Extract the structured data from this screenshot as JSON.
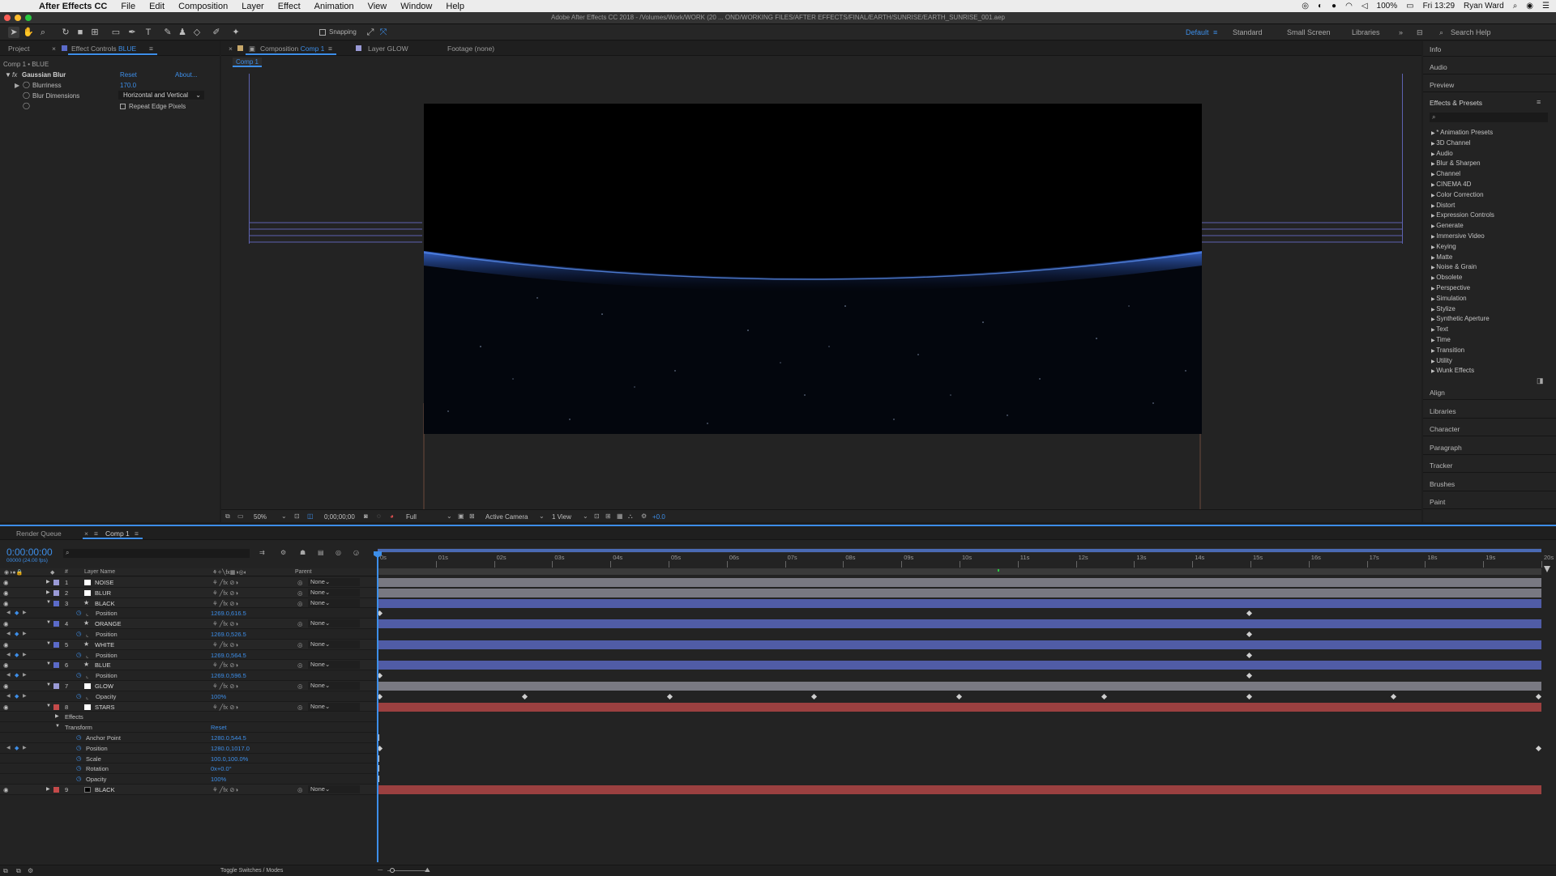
{
  "menubar": {
    "app_name": "After Effects CC",
    "menus": [
      "File",
      "Edit",
      "Composition",
      "Layer",
      "Effect",
      "Animation",
      "View",
      "Window",
      "Help"
    ],
    "battery": "100%",
    "clock": "Fri 13:29",
    "user": "Ryan Ward"
  },
  "window": {
    "title": "Adobe After Effects CC 2018 - /Volumes/Work/WORK (20 ... OND/WORKING FILES/AFTER EFFECTS/FINAL/EARTH/SUNRISE/EARTH_SUNRISE_001.aep"
  },
  "toolbar": {
    "snapping_label": "Snapping",
    "workspaces": [
      "Default",
      "Standard",
      "Small Screen",
      "Libraries"
    ],
    "active_workspace": "Default",
    "search_placeholder": "Search Help"
  },
  "effect_controls": {
    "project_tab": "Project",
    "tab_label": "Effect Controls",
    "tab_layer": "BLUE",
    "breadcrumb": "Comp 1 • BLUE",
    "effect_name": "Gaussian Blur",
    "reset": "Reset",
    "about": "About...",
    "props": [
      {
        "name": "Blurriness",
        "value": "170.0"
      },
      {
        "name": "Blur Dimensions",
        "value": "Horizontal and Vertical"
      }
    ],
    "repeat_edge": "Repeat Edge Pixels"
  },
  "composition": {
    "tab_prefix": "Composition",
    "tab_name": "Comp 1",
    "layer_tab": "Layer GLOW",
    "footage_tab": "Footage (none)",
    "subtab": "Comp 1",
    "footer": {
      "zoom": "50%",
      "timecode": "0;00;00;00",
      "resolution": "Full",
      "camera": "Active Camera",
      "views": "1 View",
      "exposure": "+0.0"
    }
  },
  "right_panel": {
    "top_tabs": [
      "Info",
      "Audio",
      "Preview"
    ],
    "effects_title": "Effects & Presets",
    "effects_items": [
      "* Animation Presets",
      "3D Channel",
      "Audio",
      "Blur & Sharpen",
      "Channel",
      "CINEMA 4D",
      "Color Correction",
      "Distort",
      "Expression Controls",
      "Generate",
      "Immersive Video",
      "Keying",
      "Matte",
      "Noise & Grain",
      "Obsolete",
      "Perspective",
      "Simulation",
      "Stylize",
      "Synthetic Aperture",
      "Text",
      "Time",
      "Transition",
      "Utility",
      "Wunk Effects"
    ],
    "bottom_tabs": [
      "Align",
      "Libraries",
      "Character",
      "Paragraph",
      "Tracker",
      "Brushes",
      "Paint"
    ]
  },
  "timeline": {
    "render_queue_tab": "Render Queue",
    "comp_tab": "Comp 1",
    "timecode": "0:00:00:00",
    "frame_info": "00000 (24.00 fps)",
    "header": {
      "num": "#",
      "layer_name": "Layer Name",
      "parent": "Parent"
    },
    "ruler_ticks": [
      "0s",
      "01s",
      "02s",
      "03s",
      "04s",
      "05s",
      "06s",
      "07s",
      "08s",
      "09s",
      "10s",
      "11s",
      "12s",
      "13s",
      "14s",
      "15s",
      "16s",
      "17s",
      "18s",
      "19s",
      "20s"
    ],
    "toggle_label": "Toggle Switches / Modes",
    "rows": [
      {
        "type": "layer",
        "num": "1",
        "name": "NOISE",
        "color": "#9a9ad6",
        "icon": "solid",
        "parent": "None",
        "bar": "#797982"
      },
      {
        "type": "layer",
        "num": "2",
        "name": "BLUR",
        "color": "#9a9ad6",
        "icon": "solid",
        "parent": "None",
        "bar": "#797982"
      },
      {
        "type": "layer",
        "num": "3",
        "name": "BLACK",
        "color": "#5b6bc9",
        "icon": "shape",
        "parent": "None",
        "bar": "#505ca6",
        "expanded": true
      },
      {
        "type": "prop",
        "name": "Position",
        "value": "1269.0,616.5",
        "keys": [
          0,
          15
        ]
      },
      {
        "type": "layer",
        "num": "4",
        "name": "ORANGE",
        "color": "#5b6bc9",
        "icon": "shape",
        "parent": "None",
        "bar": "#505ca6",
        "expanded": true
      },
      {
        "type": "prop",
        "name": "Position",
        "value": "1269.0,526.5",
        "keys": [
          15
        ]
      },
      {
        "type": "layer",
        "num": "5",
        "name": "WHITE",
        "color": "#5b6bc9",
        "icon": "shape",
        "parent": "None",
        "bar": "#505ca6",
        "expanded": true
      },
      {
        "type": "prop",
        "name": "Position",
        "value": "1269.0,564.5",
        "keys": [
          15
        ]
      },
      {
        "type": "layer",
        "num": "6",
        "name": "BLUE",
        "color": "#5b6bc9",
        "icon": "shape",
        "parent": "None",
        "bar": "#505ca6",
        "expanded": true
      },
      {
        "type": "prop",
        "name": "Position",
        "value": "1269.0,596.5",
        "keys": [
          0,
          15
        ]
      },
      {
        "type": "layer",
        "num": "7",
        "name": "GLOW",
        "color": "#9a9ad6",
        "icon": "solid",
        "parent": "None",
        "bar": "#797982",
        "expanded": true
      },
      {
        "type": "prop",
        "name": "Opacity",
        "value": "100%",
        "keys": [
          0,
          2.5,
          5,
          7.5,
          10,
          12.5,
          15,
          17.5,
          20
        ]
      },
      {
        "type": "layer",
        "num": "8",
        "name": "STARS",
        "color": "#c44a4a",
        "icon": "solid",
        "parent": "None",
        "bar": "#9b4040",
        "expanded": true
      },
      {
        "type": "group",
        "name": "Effects"
      },
      {
        "type": "group",
        "name": "Transform",
        "value": "Reset",
        "open": true
      },
      {
        "type": "subprop",
        "name": "Anchor Point",
        "value": "1280.0,544.5",
        "keys": [
          0
        ]
      },
      {
        "type": "subprop",
        "name": "Position",
        "value": "1280.0,1017.0",
        "keys": [
          0,
          20
        ],
        "animated": true
      },
      {
        "type": "subprop",
        "name": "Scale",
        "value": "100.0,100.0%",
        "keys": [
          0
        ]
      },
      {
        "type": "subprop",
        "name": "Rotation",
        "value": "0x+0.0°",
        "keys": [
          0
        ]
      },
      {
        "type": "subprop",
        "name": "Opacity",
        "value": "100%",
        "keys": [
          0
        ]
      },
      {
        "type": "layer",
        "num": "9",
        "name": "BLACK",
        "color": "#c44a4a",
        "icon": "solid-black",
        "parent": "None",
        "bar": "#9b4040"
      }
    ]
  }
}
